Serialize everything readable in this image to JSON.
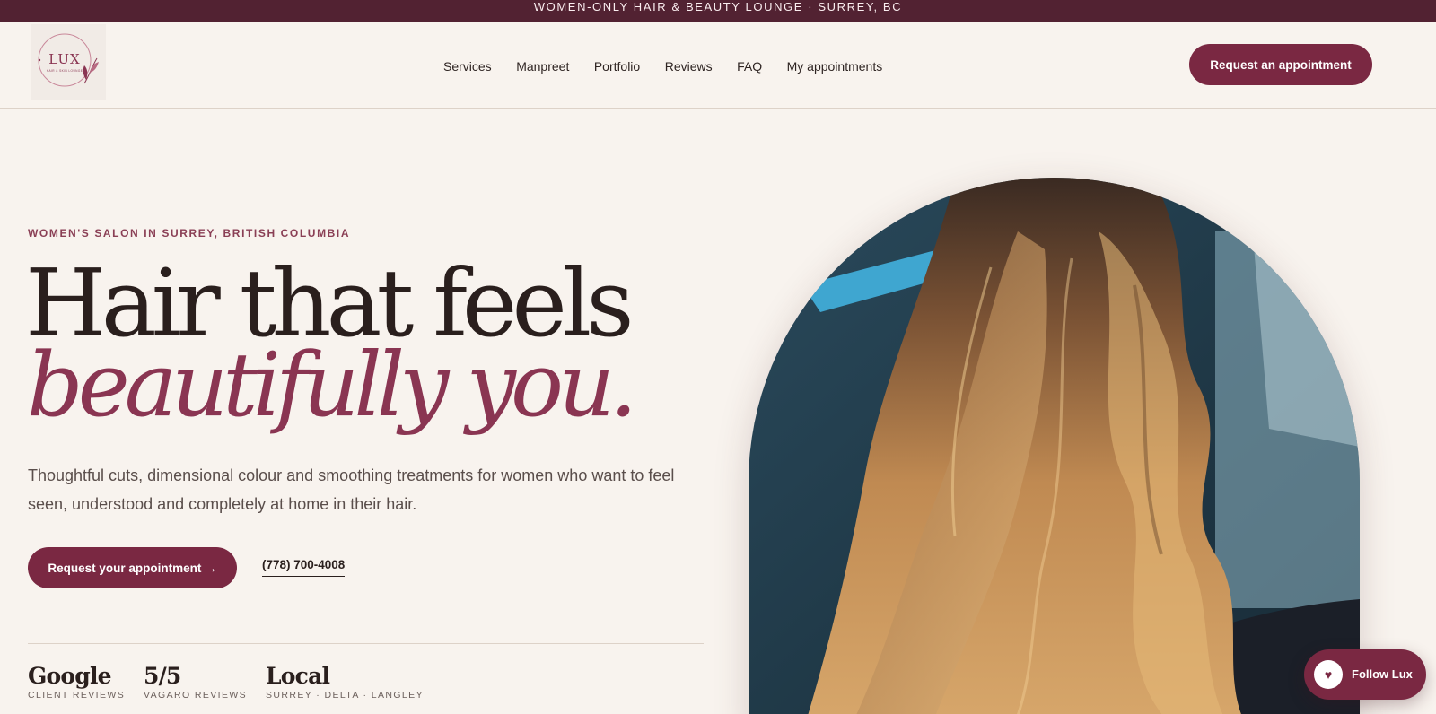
{
  "topbar": {
    "text": "WOMEN-ONLY HAIR & BEAUTY LOUNGE · SURREY, BC"
  },
  "logo": {
    "icon": "lux-logo"
  },
  "nav": {
    "items": [
      "Services",
      "Manpreet",
      "Portfolio",
      "Reviews",
      "FAQ",
      "My appointments"
    ]
  },
  "header": {
    "cta_label": "Request an appointment"
  },
  "hero": {
    "eyebrow": "WOMEN'S SALON IN SURREY, BRITISH COLUMBIA",
    "headline_line1": "Hair that feels",
    "headline_line2": "beautifully you.",
    "lead": "Thoughtful cuts, dimensional colour and smoothing treatments for women who want to feel seen, understood and completely at home in their hair.",
    "primary_cta": "Request your appointment →",
    "phone": "(778) 700-4008",
    "image_icon": "hair-photo"
  },
  "stats": [
    {
      "value": "Google",
      "label": "CLIENT REVIEWS"
    },
    {
      "value": "5/5",
      "label": "VAGARO REVIEWS"
    },
    {
      "value": "Local",
      "label": "SURREY · DELTA · LANGLEY"
    }
  ],
  "follow": {
    "label": "Follow Lux",
    "icon": "heart-icon",
    "icon_glyph": "♥"
  },
  "colors": {
    "brand": "#7a2842",
    "topbar": "#522232",
    "accent_text": "#8a3552",
    "background": "#f8f3ee"
  }
}
